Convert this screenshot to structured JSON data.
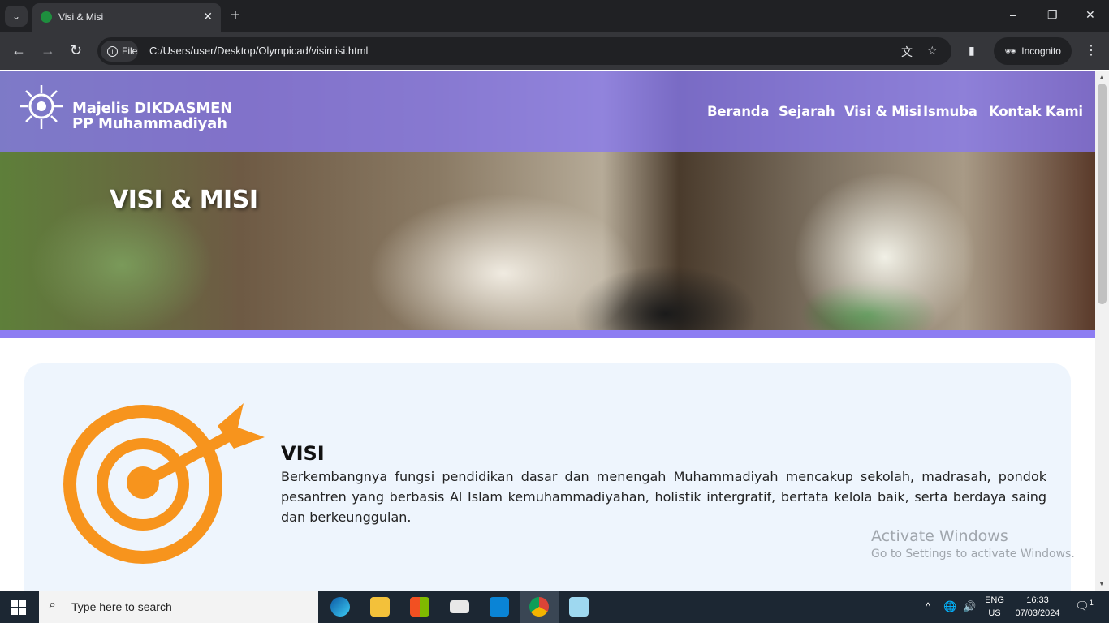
{
  "browser": {
    "tab_title": "Visi & Misi",
    "tab_close": "✕",
    "new_tab": "+",
    "url_chip": "File",
    "url": "C:/Users/user/Desktop/Olympicad/visimisi.html",
    "incognito_label": "Incognito",
    "window_controls": [
      "–",
      "❐",
      "✕"
    ]
  },
  "site": {
    "brand_line1": "Majelis DIKDASMEN",
    "brand_line2": "PP Muhammadiyah",
    "nav": [
      "Beranda",
      "Sejarah",
      "Visi & Misi",
      "Ismuba",
      "Kontak Kami"
    ],
    "hero_title": "VISI & MISI",
    "accent_color": "#8d7df2",
    "target_color": "#f7941d"
  },
  "content": {
    "visi_heading": "VISI",
    "visi_text": "Berkembangnya fungsi pendidikan dasar dan menengah Muhammadiyah mencakup sekolah, madrasah, pondok pesantren yang berbasis Al Islam kemuhammadiyahan, holistik intergratif, bertata kelola baik, serta berdaya saing dan berkeunggulan."
  },
  "watermark": {
    "line1": "Activate Windows",
    "line2": "Go to Settings to activate Windows."
  },
  "taskbar": {
    "search_placeholder": "Type here to search",
    "apps": [
      "edge-icon",
      "file-explorer-icon",
      "store-icon",
      "mail-icon",
      "vscode-icon",
      "chrome-icon",
      "notepad-icon"
    ],
    "lang_line1": "ENG",
    "lang_line2": "US",
    "time": "16:33",
    "date": "07/03/2024",
    "notification_count": "1"
  }
}
